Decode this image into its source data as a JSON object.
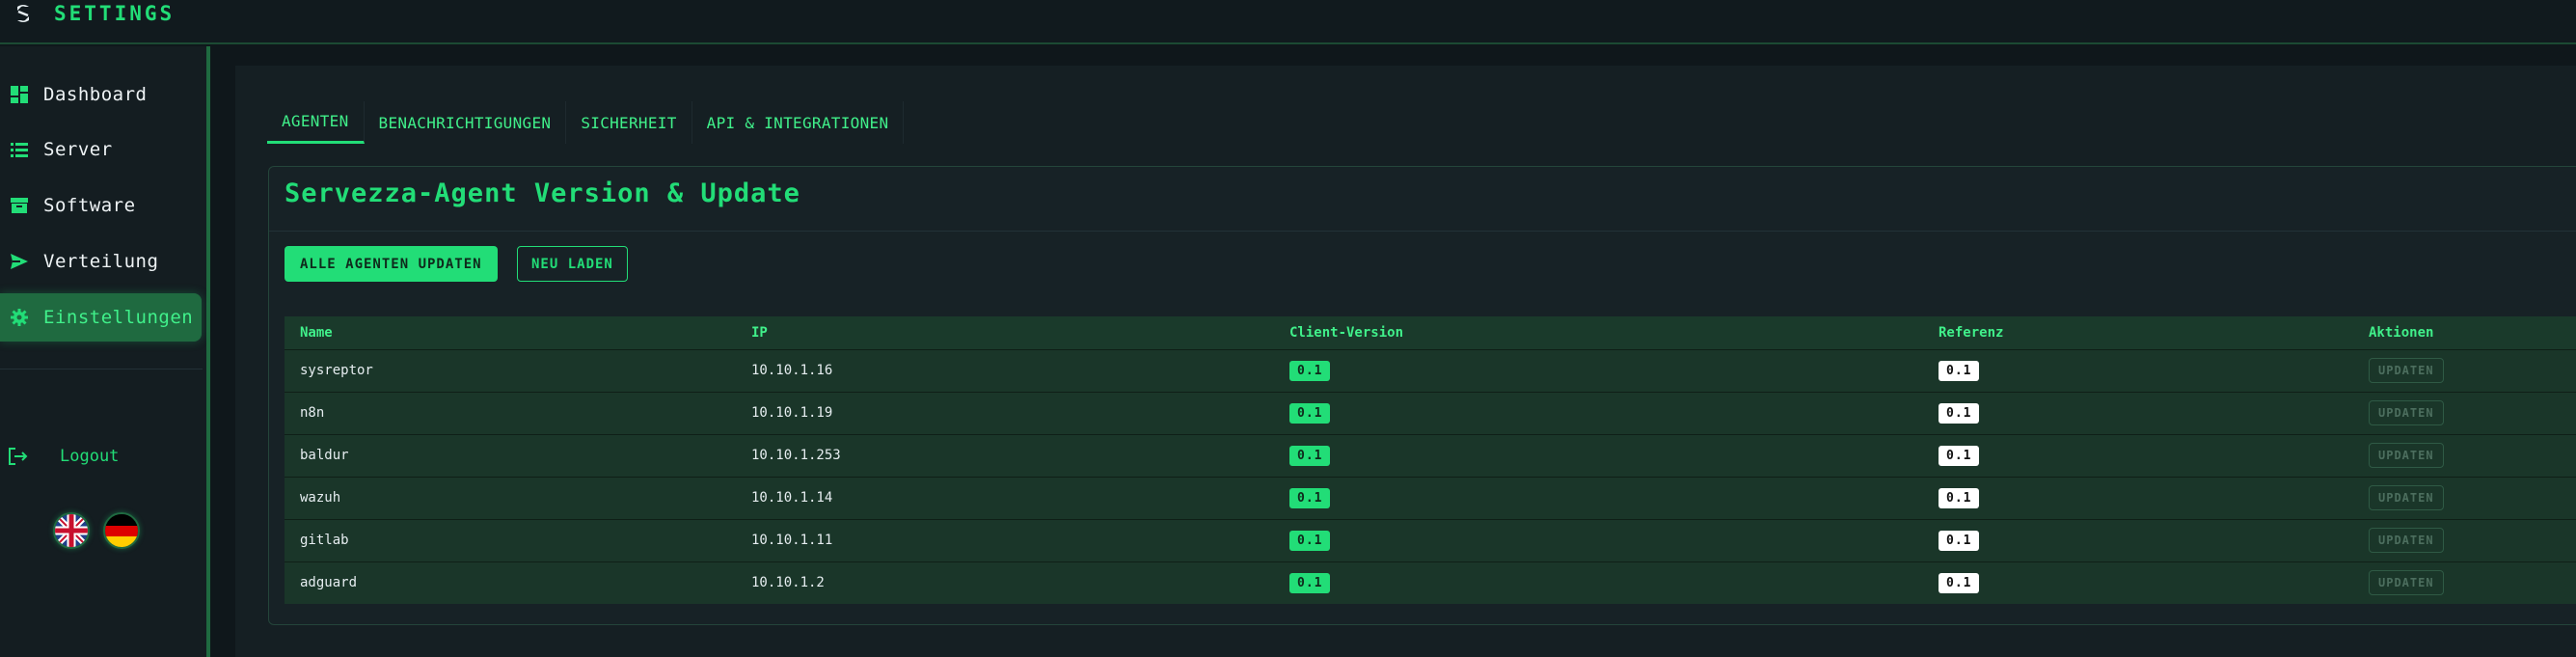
{
  "app": {
    "title": "SETTINGS"
  },
  "sidebar": {
    "items": [
      {
        "label": "Dashboard",
        "icon": "grid-icon"
      },
      {
        "label": "Server",
        "icon": "list-icon"
      },
      {
        "label": "Software",
        "icon": "archive-icon"
      },
      {
        "label": "Verteilung",
        "icon": "send-icon"
      },
      {
        "label": "Einstellungen",
        "icon": "gear-icon",
        "active": true
      }
    ],
    "logout_label": "Logout"
  },
  "tabs": [
    {
      "label": "AGENTEN",
      "active": true
    },
    {
      "label": "BENACHRICHTIGUNGEN"
    },
    {
      "label": "SICHERHEIT"
    },
    {
      "label": "API & INTEGRATIONEN"
    }
  ],
  "card": {
    "title": "Servezza-Agent Version & Update",
    "update_all_label": "ALLE AGENTEN UPDATEN",
    "reload_label": "NEU LADEN"
  },
  "table": {
    "headers": [
      "Name",
      "IP",
      "Client-Version",
      "Referenz",
      "Aktionen"
    ],
    "action_label": "UPDATEN",
    "rows": [
      {
        "name": "sysreptor",
        "ip": "10.10.1.16",
        "client": "0.1",
        "ref": "0.1"
      },
      {
        "name": "n8n",
        "ip": "10.10.1.19",
        "client": "0.1",
        "ref": "0.1"
      },
      {
        "name": "baldur",
        "ip": "10.10.1.253",
        "client": "0.1",
        "ref": "0.1"
      },
      {
        "name": "wazuh",
        "ip": "10.10.1.14",
        "client": "0.1",
        "ref": "0.1"
      },
      {
        "name": "gitlab",
        "ip": "10.10.1.11",
        "client": "0.1",
        "ref": "0.1"
      },
      {
        "name": "adguard",
        "ip": "10.10.1.2",
        "client": "0.1",
        "ref": "0.1"
      }
    ]
  },
  "colors": {
    "accent": "#22dd77",
    "active_bg": "#1f6a40"
  }
}
